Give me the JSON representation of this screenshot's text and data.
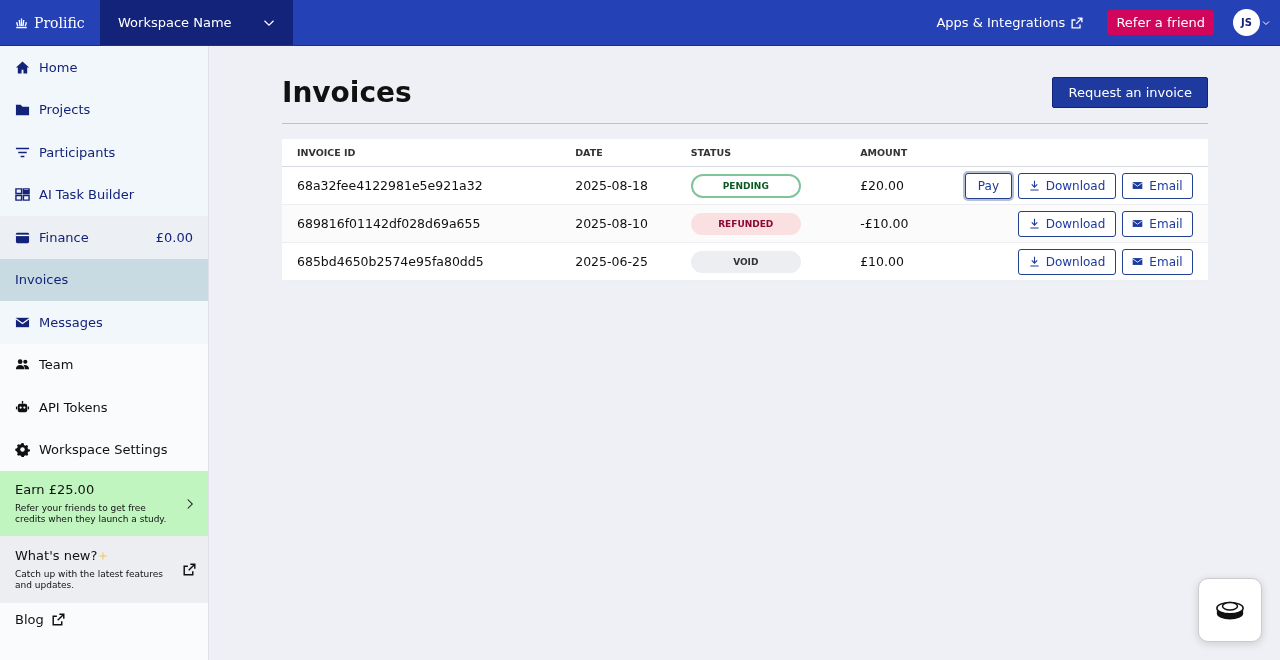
{
  "topbar": {
    "logo": "Prolific",
    "workspace": "Workspace Name",
    "apps_link": "Apps & Integrations",
    "refer_button": "Refer a friend",
    "avatar": "JS"
  },
  "sidebar": {
    "items": [
      {
        "label": "Home",
        "kind": "nav",
        "selected": false
      },
      {
        "label": "Projects",
        "kind": "nav",
        "selected": false
      },
      {
        "label": "Participants",
        "kind": "nav",
        "selected": false
      },
      {
        "label": "AI Task Builder",
        "kind": "nav",
        "selected": false
      },
      {
        "label": "Finance",
        "kind": "group",
        "amount": "£0.00",
        "selected": false
      },
      {
        "label": "Invoices",
        "kind": "sub",
        "selected": true
      },
      {
        "label": "Messages",
        "kind": "nav",
        "selected": false
      },
      {
        "label": "Team",
        "kind": "plain",
        "selected": false
      },
      {
        "label": "API Tokens",
        "kind": "plain",
        "selected": false
      },
      {
        "label": "Workspace Settings",
        "kind": "plain",
        "selected": false
      }
    ],
    "promo": {
      "title": "Earn £25.00",
      "text": "Refer your friends to get free credits when they launch a study."
    },
    "whats_new": {
      "title": "What's new?",
      "text": "Catch up with the latest features and updates."
    },
    "blog": "Blog"
  },
  "page": {
    "title": "Invoices",
    "request_button": "Request an invoice"
  },
  "table": {
    "columns": [
      "INVOICE ID",
      "DATE",
      "STATUS",
      "AMOUNT"
    ],
    "rows": [
      {
        "id": "68a32fee4122981e5e921a32",
        "date": "2025-08-18",
        "status": {
          "label": "PENDING",
          "kind": "pending"
        },
        "amount": "£20.00",
        "actions": [
          {
            "label": "Pay",
            "kind": "pay",
            "focused": true
          },
          {
            "label": "Download",
            "kind": "download",
            "focused": false
          },
          {
            "label": "Email",
            "kind": "email",
            "focused": false
          }
        ]
      },
      {
        "id": "689816f01142df028d69a655",
        "date": "2025-08-10",
        "status": {
          "label": "REFUNDED",
          "kind": "refunded"
        },
        "amount": "-£10.00",
        "actions": [
          {
            "label": "Download",
            "kind": "download",
            "focused": false
          },
          {
            "label": "Email",
            "kind": "email",
            "focused": false
          }
        ]
      },
      {
        "id": "685bd4650b2574e95fa80dd5",
        "date": "2025-06-25",
        "status": {
          "label": "VOID",
          "kind": "void"
        },
        "amount": "£10.00",
        "actions": [
          {
            "label": "Download",
            "kind": "download",
            "focused": false
          },
          {
            "label": "Email",
            "kind": "email",
            "focused": false
          }
        ]
      }
    ]
  }
}
